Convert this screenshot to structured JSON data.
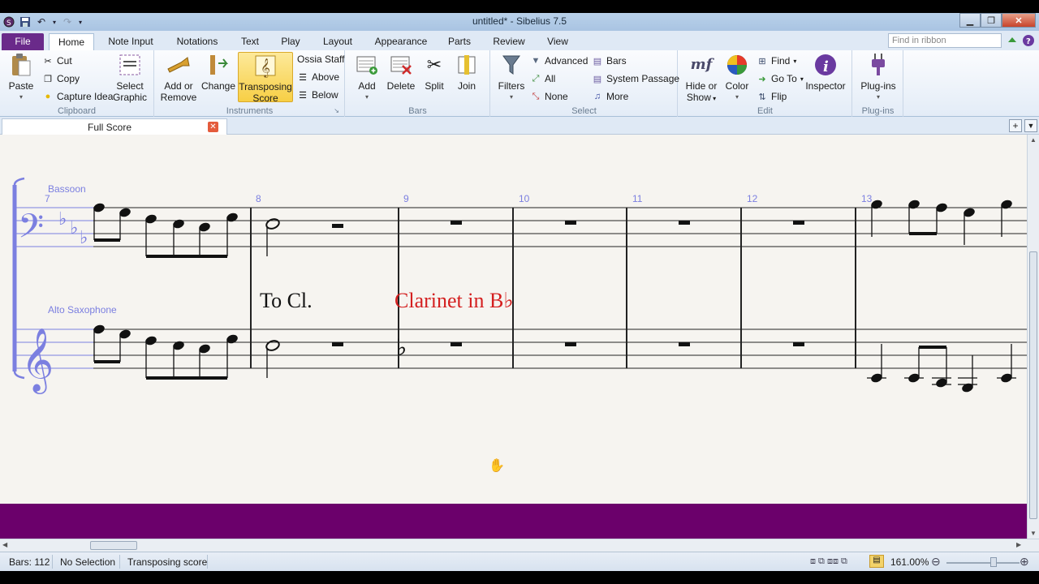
{
  "window": {
    "title": "untitled* - Sibelius 7.5"
  },
  "menu_tabs": [
    "File",
    "Home",
    "Note Input",
    "Notations",
    "Text",
    "Play",
    "Layout",
    "Appearance",
    "Parts",
    "Review",
    "View"
  ],
  "ribbon_search_placeholder": "Find in ribbon",
  "ribbon": {
    "clipboard": {
      "label": "Clipboard",
      "paste": "Paste",
      "cut": "Cut",
      "copy": "Copy",
      "capture_idea": "Capture Idea",
      "select_graphic_1": "Select",
      "select_graphic_2": "Graphic"
    },
    "instruments": {
      "label": "Instruments",
      "add_remove_1": "Add or",
      "add_remove_2": "Remove",
      "change": "Change",
      "transposing_1": "Transposing",
      "transposing_2": "Score",
      "ossia_staff": "Ossia Staff",
      "above": "Above",
      "below": "Below"
    },
    "bars": {
      "label": "Bars",
      "add": "Add",
      "delete": "Delete",
      "split": "Split",
      "join": "Join"
    },
    "select": {
      "label": "Select",
      "filters": "Filters",
      "advanced": "Advanced",
      "all": "All",
      "none": "None",
      "bars": "Bars",
      "system_passage": "System Passage",
      "more": "More"
    },
    "edit": {
      "label": "Edit",
      "hide_show_1": "Hide or",
      "hide_show_2": "Show",
      "color": "Color",
      "find": "Find",
      "go_to": "Go To",
      "flip": "Flip",
      "inspector": "Inspector"
    },
    "plugins": {
      "label": "Plug-ins",
      "plugins": "Plug-ins"
    }
  },
  "document_tab": "Full Score",
  "score": {
    "instrument_1": "Bassoon",
    "instrument_2": "Alto Saxophone",
    "bar_numbers": [
      "7",
      "8",
      "9",
      "10",
      "11",
      "12",
      "13"
    ],
    "text_to_cl": "To Cl.",
    "text_clarinet": "Clarinet in B♭"
  },
  "status": {
    "bars": "Bars: 112",
    "selection": "No Selection",
    "mode": "Transposing score",
    "zoom": "161.00%"
  },
  "colors": {
    "file_tab": "#6a2a8a",
    "band": "#6b006b",
    "selected_staff": "#7b7fe0",
    "instrument_change": "#d41f1f"
  }
}
